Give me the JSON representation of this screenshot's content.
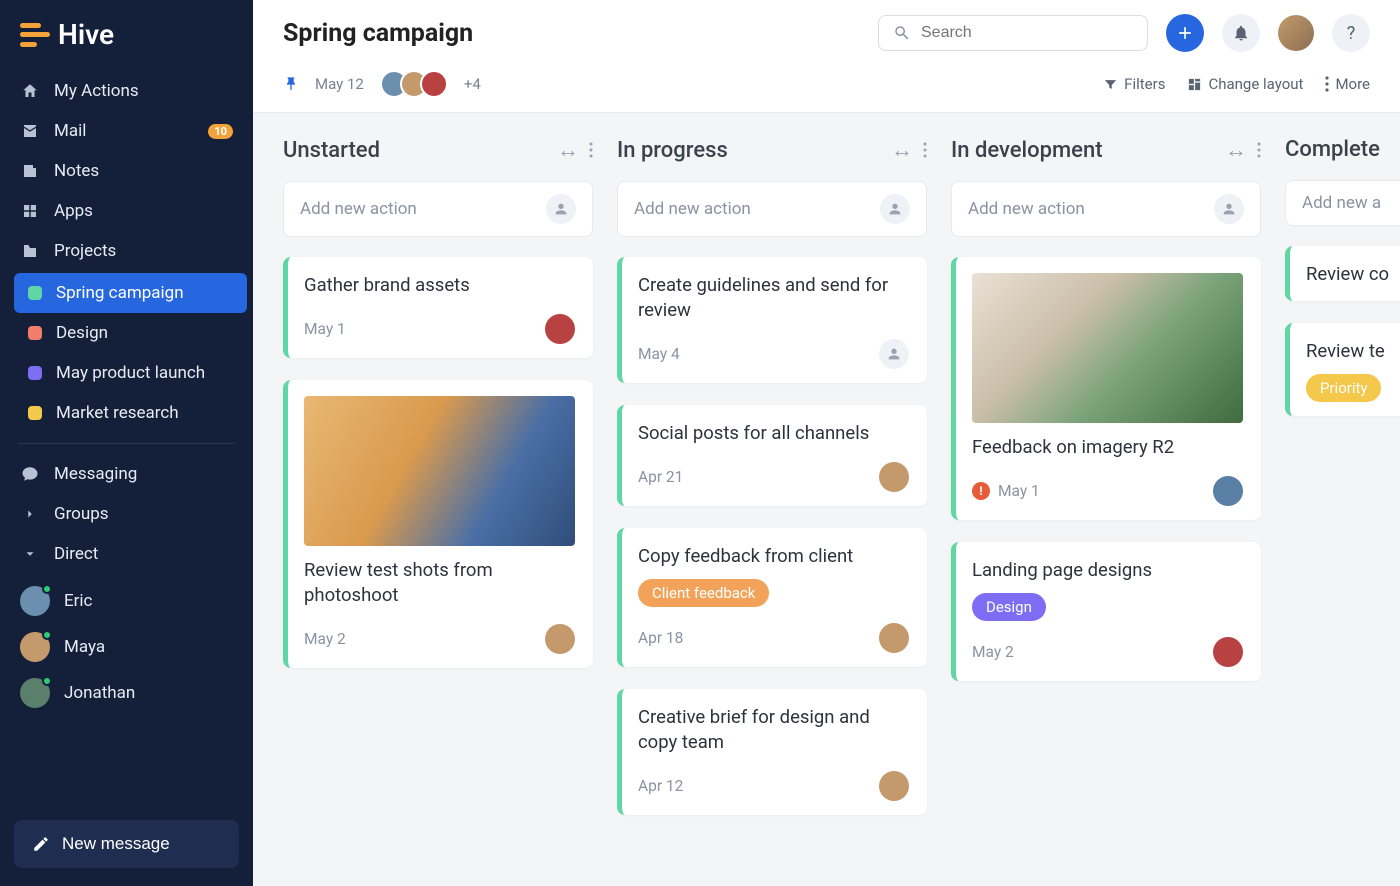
{
  "app_name": "Hive",
  "header": {
    "title": "Spring campaign",
    "search_placeholder": "Search"
  },
  "subheader": {
    "date": "May 12",
    "more_count": "+4",
    "filters": "Filters",
    "change_layout": "Change layout",
    "more": "More"
  },
  "sidebar": {
    "items": [
      {
        "label": "My Actions",
        "icon": "home"
      },
      {
        "label": "Mail",
        "icon": "mail",
        "badge": "10"
      },
      {
        "label": "Notes",
        "icon": "note"
      },
      {
        "label": "Apps",
        "icon": "apps"
      },
      {
        "label": "Projects",
        "icon": "folder"
      }
    ],
    "projects": [
      {
        "label": "Spring campaign",
        "color": "#5fd6a3",
        "active": true
      },
      {
        "label": "Design",
        "color": "#f27d6a"
      },
      {
        "label": "May product launch",
        "color": "#7e6df2"
      },
      {
        "label": "Market research",
        "color": "#f4c84a"
      }
    ],
    "messaging_label": "Messaging",
    "groups_label": "Groups",
    "direct_label": "Direct",
    "dms": [
      {
        "name": "Eric"
      },
      {
        "name": "Maya"
      },
      {
        "name": "Jonathan"
      }
    ],
    "new_message": "New message"
  },
  "board": {
    "add_placeholder": "Add new action",
    "columns": [
      {
        "title": "Unstarted",
        "cards": [
          {
            "title": "Gather brand assets",
            "date": "May 1",
            "assignee_color": "#b84141"
          },
          {
            "title": "Review test shots from photoshoot",
            "date": "May 2",
            "assignee_color": "#c49a6c",
            "image": "linear-gradient(120deg,#e8b873 0%,#d99a4e 40%,#4a6fa5 70%,#2f4d7a 100%)"
          }
        ]
      },
      {
        "title": "In progress",
        "cards": [
          {
            "title": "Create guidelines and send for review",
            "date": "May 4",
            "empty_assignee": true
          },
          {
            "title": "Social posts for all channels",
            "date": "Apr 21",
            "assignee_color": "#c49a6c"
          },
          {
            "title": "Copy feedback from client",
            "date": "Apr 18",
            "assignee_color": "#c49a6c",
            "tag": {
              "text": "Client feedback",
              "color": "#f2a259"
            }
          },
          {
            "title": "Creative brief for design and copy team",
            "date": "Apr 12",
            "assignee_color": "#c49a6c"
          }
        ]
      },
      {
        "title": "In development",
        "cards": [
          {
            "title": "Feedback on imagery R2",
            "date": "May 1",
            "assignee_color": "#5a7fa5",
            "alert": true,
            "image": "linear-gradient(135deg,#e9e1d6 0%,#cbbfa9 35%,#7aa37a 60%,#3f6b3f 100%)"
          },
          {
            "title": "Landing page designs",
            "date": "May 2",
            "assignee_color": "#b84141",
            "tag": {
              "text": "Design",
              "color": "#7e6df2"
            }
          }
        ]
      },
      {
        "title": "Complete",
        "cut": true,
        "cards": [
          {
            "title": "Review co",
            "date": ""
          },
          {
            "title": "Review te",
            "date": "",
            "tag": {
              "text": "Priority",
              "color": "#f4c84a"
            }
          }
        ]
      }
    ]
  }
}
